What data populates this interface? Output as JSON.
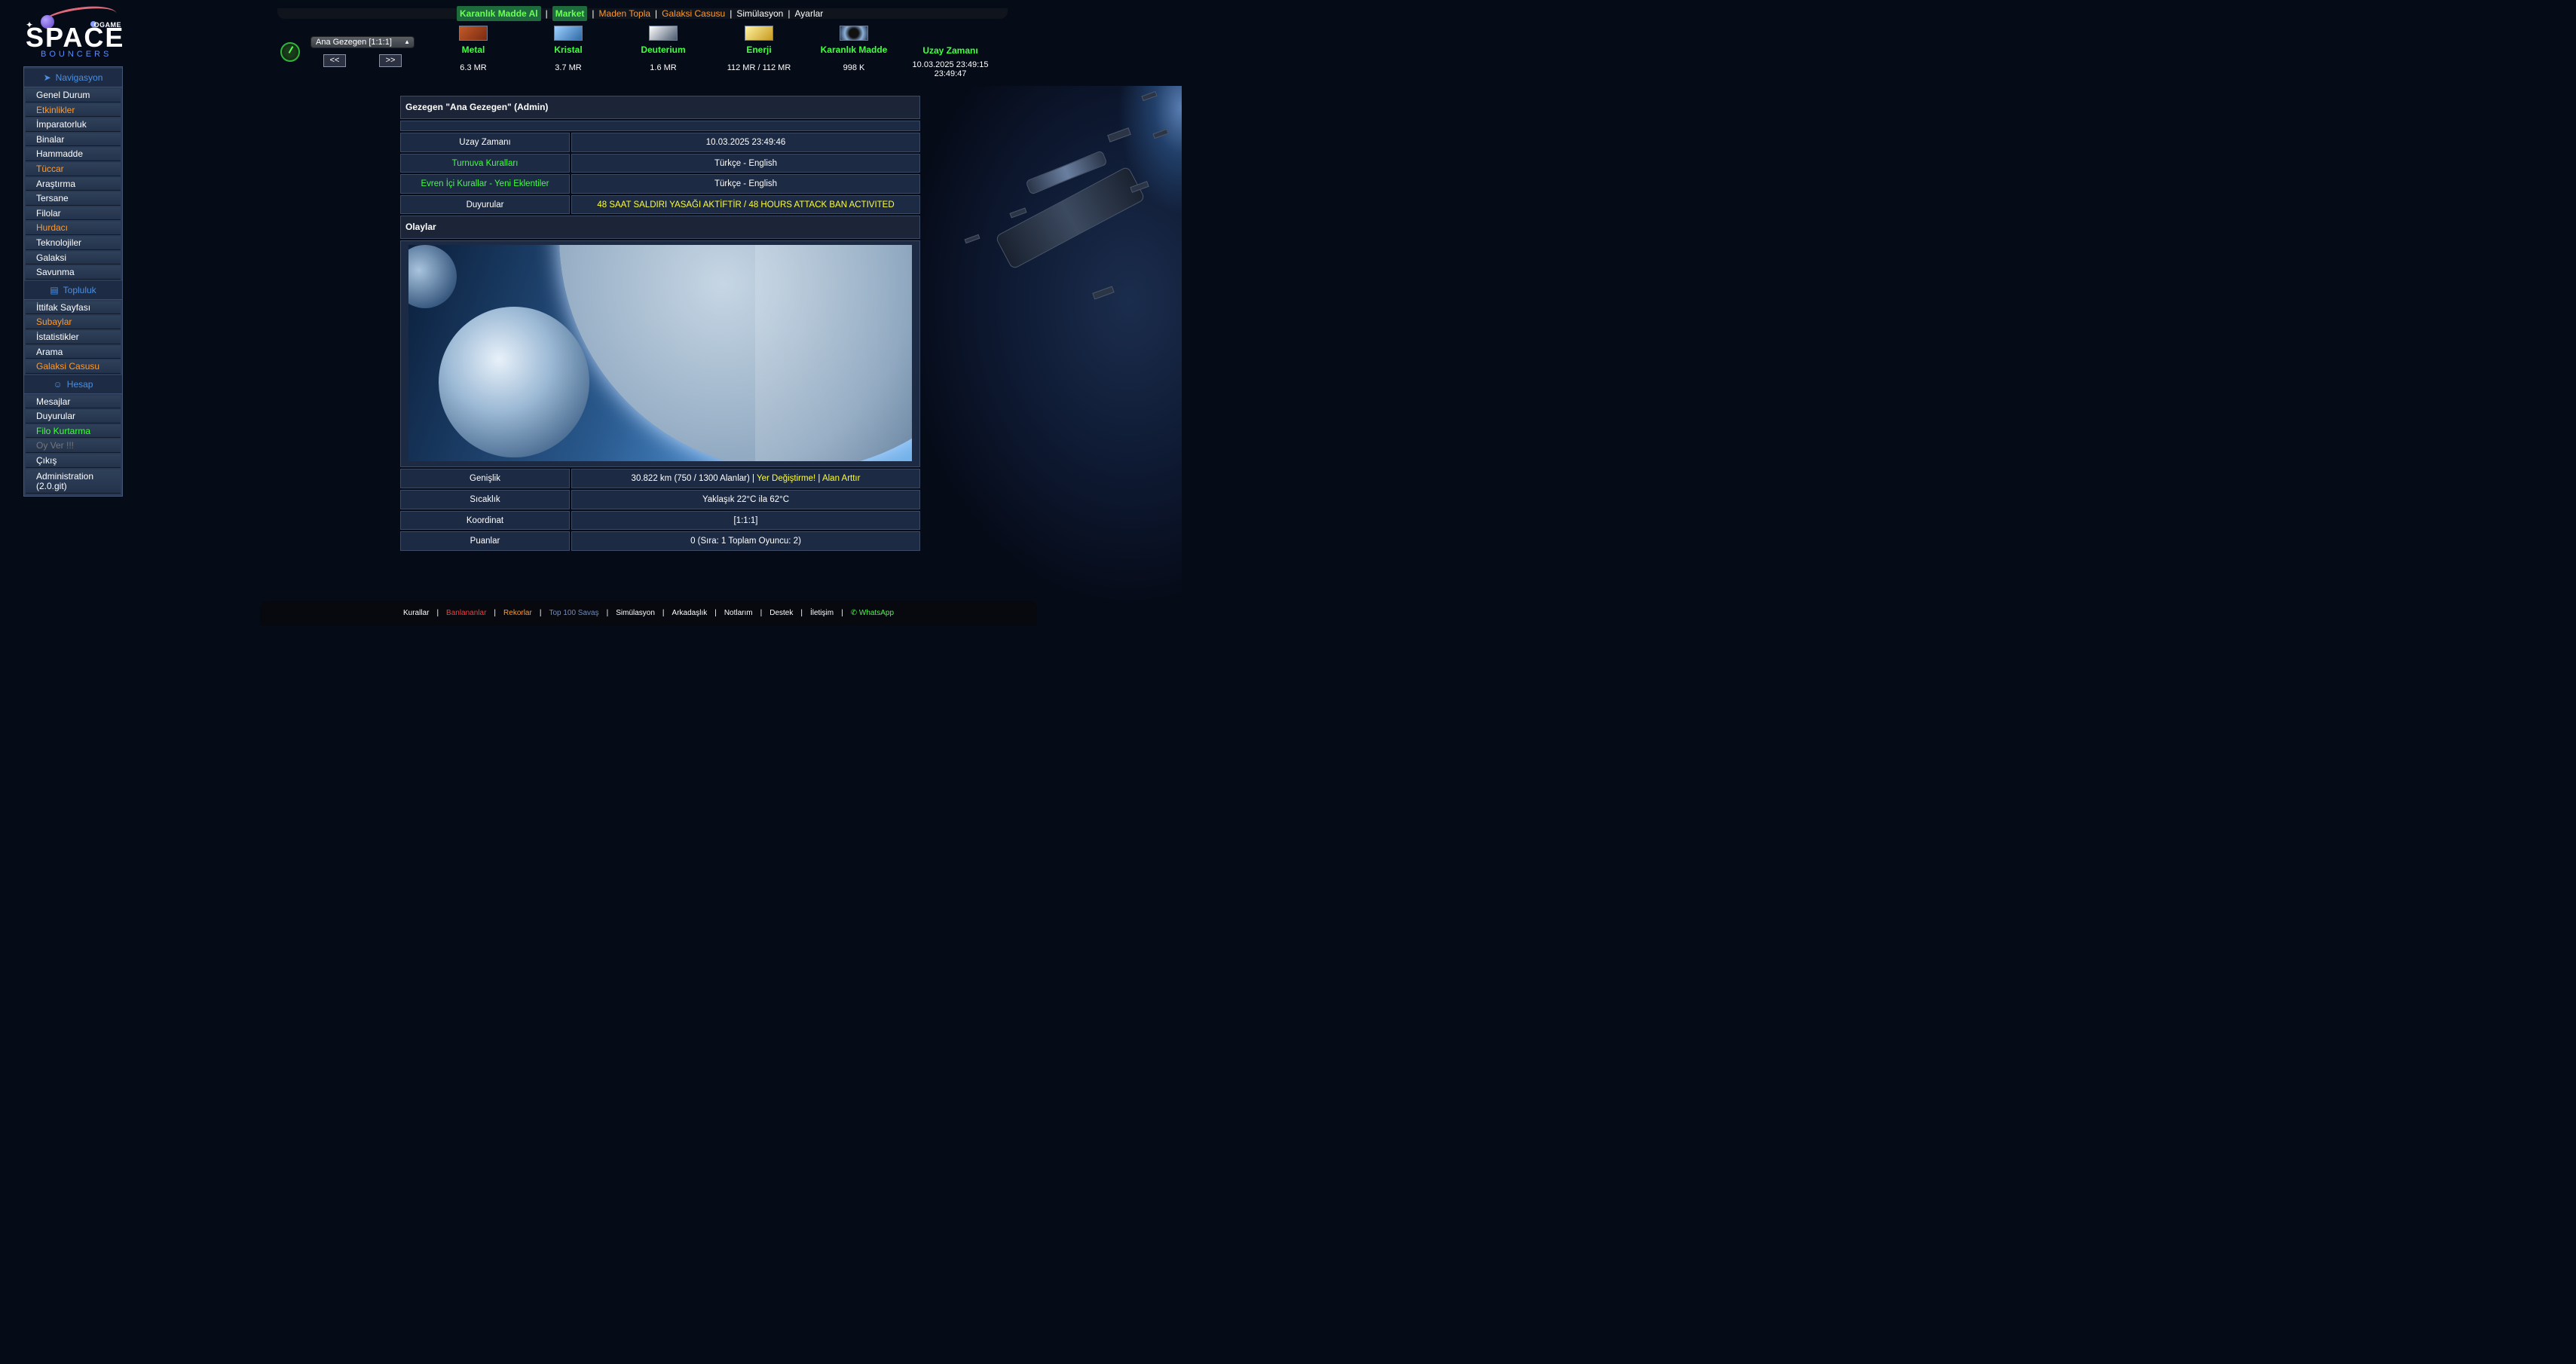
{
  "logo": {
    "ogame": "OGAME",
    "space": "SPACE",
    "bouncers": "BOUNCERS"
  },
  "topnav": {
    "dark_matter": "Karanlık Madde Al",
    "market": "Market",
    "mine": "Maden Topla",
    "spy": "Galaksi Casusu",
    "sim": "Simülasyon",
    "settings": "Ayarlar"
  },
  "planet_selector": {
    "value": "Ana Gezegen [1:1:1]",
    "prev": "<<",
    "next": ">>"
  },
  "resources": {
    "metal": {
      "name": "Metal",
      "value": "6.3 MR"
    },
    "crystal": {
      "name": "Kristal",
      "value": "3.7 MR"
    },
    "deuterium": {
      "name": "Deuterium",
      "value": "1.6 MR"
    },
    "energy": {
      "name": "Enerji",
      "value": "112 MR / 112 MR"
    },
    "darkmatter": {
      "name": "Karanlık Madde",
      "value": "998 K"
    },
    "time": {
      "name": "Uzay Zamanı",
      "value": "10.03.2025 23:49:15",
      "value2": "23:49:47"
    }
  },
  "sidebar": {
    "nav_head": "Navigasyon",
    "nav": [
      {
        "label": "Genel Durum",
        "color": "#ffffff"
      },
      {
        "label": "Etkinlikler",
        "color": "#ff9a2e"
      },
      {
        "label": "İmparatorluk",
        "color": "#ffffff"
      },
      {
        "label": "Binalar",
        "color": "#ffffff"
      },
      {
        "label": "Hammadde",
        "color": "#ffffff"
      },
      {
        "label": "Tüccar",
        "color": "#ff9a2e"
      },
      {
        "label": "Araştırma",
        "color": "#ffffff"
      },
      {
        "label": "Tersane",
        "color": "#ffffff"
      },
      {
        "label": "Filolar",
        "color": "#ffffff"
      },
      {
        "label": "Hurdacı",
        "color": "#ff9a2e"
      },
      {
        "label": "Teknolojiler",
        "color": "#ffffff"
      },
      {
        "label": "Galaksi",
        "color": "#ffffff"
      },
      {
        "label": "Savunma",
        "color": "#ffffff"
      }
    ],
    "community_head": "Topluluk",
    "community": [
      {
        "label": "İttifak Sayfası",
        "color": "#ffffff"
      },
      {
        "label": "Subaylar",
        "color": "#ff9a2e"
      },
      {
        "label": "İstatistikler",
        "color": "#ffffff"
      },
      {
        "label": "Arama",
        "color": "#ffffff"
      },
      {
        "label": "Galaksi Casusu",
        "color": "#ff9a2e"
      }
    ],
    "account_head": "Hesap",
    "account": [
      {
        "label": "Mesajlar",
        "color": "#ffffff"
      },
      {
        "label": "Duyurular",
        "color": "#ffffff"
      },
      {
        "label": "Filo Kurtarma",
        "color": "#41ff3f"
      },
      {
        "label": "Oy Ver !!!",
        "color": "#777777"
      },
      {
        "label": "Çıkış",
        "color": "#ffffff"
      },
      {
        "label": "Administration (2.0.git)",
        "color": "#ffffff"
      }
    ]
  },
  "main": {
    "title": "Gezegen \"Ana Gezegen\" (Admin)",
    "rows1": [
      {
        "label": "Uzay Zamanı",
        "value": "10.03.2025 23:49:46"
      },
      {
        "label": "Turnuva Kuralları",
        "value": "Türkçe - English"
      },
      {
        "label": "Evren İçi Kurallar - Yeni Eklentiler",
        "value": "Türkçe - English"
      },
      {
        "label": "Duyurular",
        "value": "48 SAAT SALDIRI YASAĞI AKTİFTİR / 48 HOURS ATTACK BAN ACTIVITED"
      }
    ],
    "events_title": "Olaylar",
    "size_label": "Genişlik",
    "size_value": "30.822 km (750 / 1300 Alanlar) |",
    "size_link1": "Yer Değiştirme!",
    "size_sep": "|",
    "size_link2": "Alan Arttır",
    "temp_label": "Sıcaklık",
    "temp_value": "Yaklaşık 22°C ila 62°C",
    "coord_label": "Koordinat",
    "coord_value": "[1:1:1]",
    "points_label": "Puanlar",
    "points_value": "0 (Sıra: 1 Toplam Oyuncu: 2)"
  },
  "footer": {
    "rules": "Kurallar",
    "banned": "Banlananlar",
    "records": "Rekorlar",
    "top100": "Top 100 Savaş",
    "sim": "Simülasyon",
    "friends": "Arkadaşlık",
    "notes": "Notlarım",
    "support": "Destek",
    "contact": "İletişim",
    "whatsapp": "WhatsApp"
  },
  "colors": {
    "green": "#41ff3f",
    "orange": "#ff9a2e",
    "yellow": "#ffff33",
    "red": "#ff3a3a",
    "blue": "#4a90e2"
  }
}
